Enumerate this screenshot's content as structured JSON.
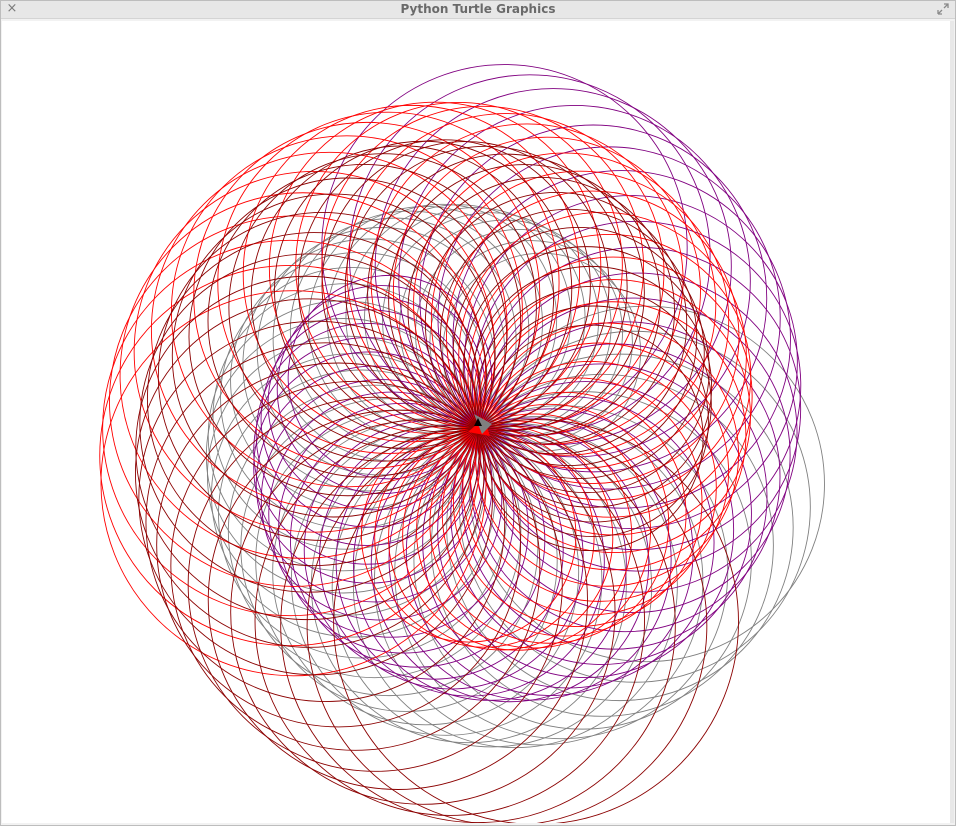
{
  "window": {
    "title": "Python Turtle Graphics",
    "close_glyph": "×"
  },
  "canvas": {
    "background": "#ffffff",
    "spiros": [
      {
        "color": "#808080",
        "circles": 36,
        "radius": 180,
        "spin": 50
      },
      {
        "color": "#800080",
        "circles": 36,
        "radius": 185,
        "spin": 150
      },
      {
        "color": "#ff0000",
        "circles": 36,
        "radius": 195,
        "spin": 265
      },
      {
        "color": "#8b0000",
        "circles": 36,
        "radius": 205,
        "spin": 355
      }
    ],
    "turtle_colors": [
      "#ff0000",
      "#808080",
      "#000000"
    ]
  }
}
